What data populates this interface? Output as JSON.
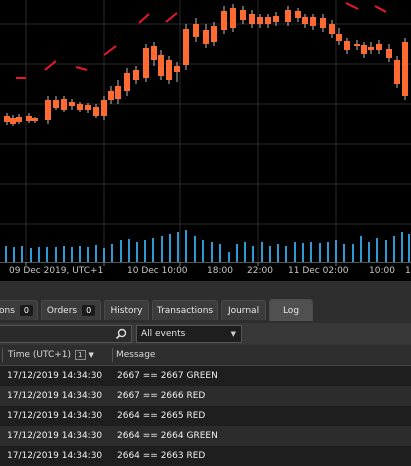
{
  "chart": {
    "time_axis_labels": [
      "09 Dec 2019, UTC+1",
      "10 Dec 10:00",
      "18:00",
      "22:00",
      "11 Dec 02:00",
      "10:00",
      "1"
    ],
    "colors": {
      "bull": "#2ea043",
      "bear": "#ff6a33",
      "signal": "#e8182a",
      "volume": "#2d9ad6",
      "grid": "#2a2a2a"
    }
  },
  "tabs": [
    {
      "label": "ons",
      "badge": "0"
    },
    {
      "label": "Orders",
      "badge": "0"
    },
    {
      "label": "History"
    },
    {
      "label": "Transactions"
    },
    {
      "label": "Journal"
    },
    {
      "label": "Log",
      "active": true
    }
  ],
  "toolbar": {
    "search_placeholder": "",
    "filter_value": "All events"
  },
  "log": {
    "columns": {
      "time": "Time (UTC+1)",
      "sort_badge": "1",
      "message": "Message"
    },
    "rows": [
      {
        "time": "17/12/2019 14:34:30",
        "message": "2667 == 2667 GREEN"
      },
      {
        "time": "17/12/2019 14:34:30",
        "message": "2667 == 2666 RED"
      },
      {
        "time": "17/12/2019 14:34:30",
        "message": "2664 == 2665 RED"
      },
      {
        "time": "17/12/2019 14:34:30",
        "message": "2664 == 2664 GREEN"
      },
      {
        "time": "17/12/2019 14:34:30",
        "message": "2664 == 2663 RED"
      }
    ]
  }
}
